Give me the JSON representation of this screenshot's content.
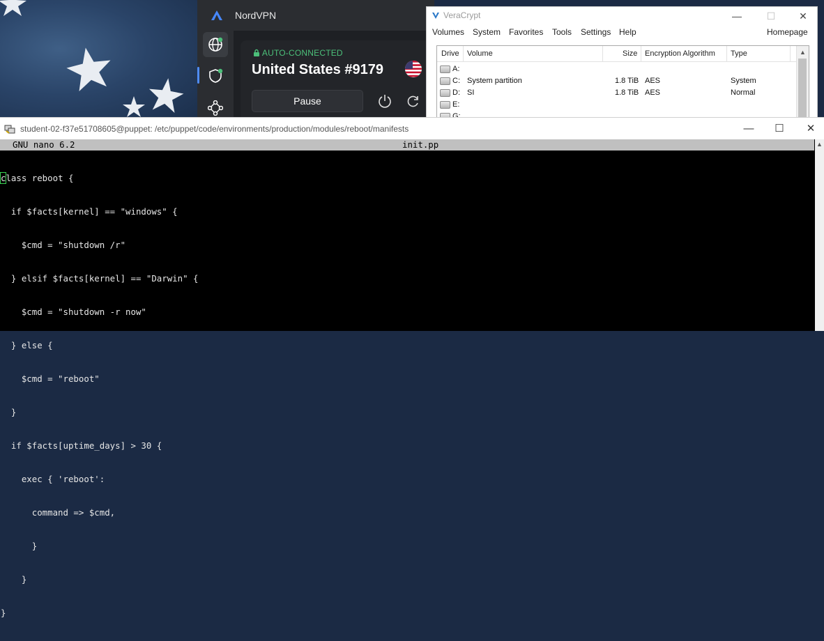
{
  "nordvpn": {
    "title": "NordVPN",
    "status": "AUTO-CONNECTED",
    "server": "United States #9179",
    "pause_label": "Pause",
    "accent": "#4cc07a",
    "icons": [
      "globe-icon",
      "shield-icon",
      "meshnet-icon",
      "power-icon",
      "refresh-icon",
      "us-flag-icon"
    ]
  },
  "veracrypt": {
    "title": "VeraCrypt",
    "menu": [
      "Volumes",
      "System",
      "Favorites",
      "Tools",
      "Settings",
      "Help"
    ],
    "homepage": "Homepage",
    "columns": [
      "Drive",
      "Volume",
      "Size",
      "Encryption Algorithm",
      "Type"
    ],
    "rows": [
      {
        "drive": "A:",
        "volume": "",
        "size": "",
        "algorithm": "",
        "type": ""
      },
      {
        "drive": "C:",
        "volume": "System partition",
        "size": "1.8 TiB",
        "algorithm": "AES",
        "type": "System"
      },
      {
        "drive": "D:",
        "volume": "SI",
        "size": "1.8 TiB",
        "algorithm": "AES",
        "type": "Normal"
      },
      {
        "drive": "E:",
        "volume": "",
        "size": "",
        "algorithm": "",
        "type": ""
      },
      {
        "drive": "G:",
        "volume": "",
        "size": "",
        "algorithm": "",
        "type": ""
      }
    ]
  },
  "terminal": {
    "title": "student-02-f37e51708605@puppet: /etc/puppet/code/environments/production/modules/reboot/manifests",
    "nano_version": "GNU nano 6.2",
    "filename": "init.pp",
    "code_lines": [
      "class reboot {",
      "  if $facts[kernel] == \"windows\" {",
      "    $cmd = \"shutdown /r\"",
      "  } elsif $facts[kernel] == \"Darwin\" {",
      "    $cmd = \"shutdown -r now\"",
      "  } else {",
      "    $cmd = \"reboot\"",
      "  }",
      "  if $facts[uptime_days] > 30 {",
      "    exec { 'reboot':",
      "      command => $cmd,",
      "      }",
      "    }",
      "}"
    ]
  }
}
